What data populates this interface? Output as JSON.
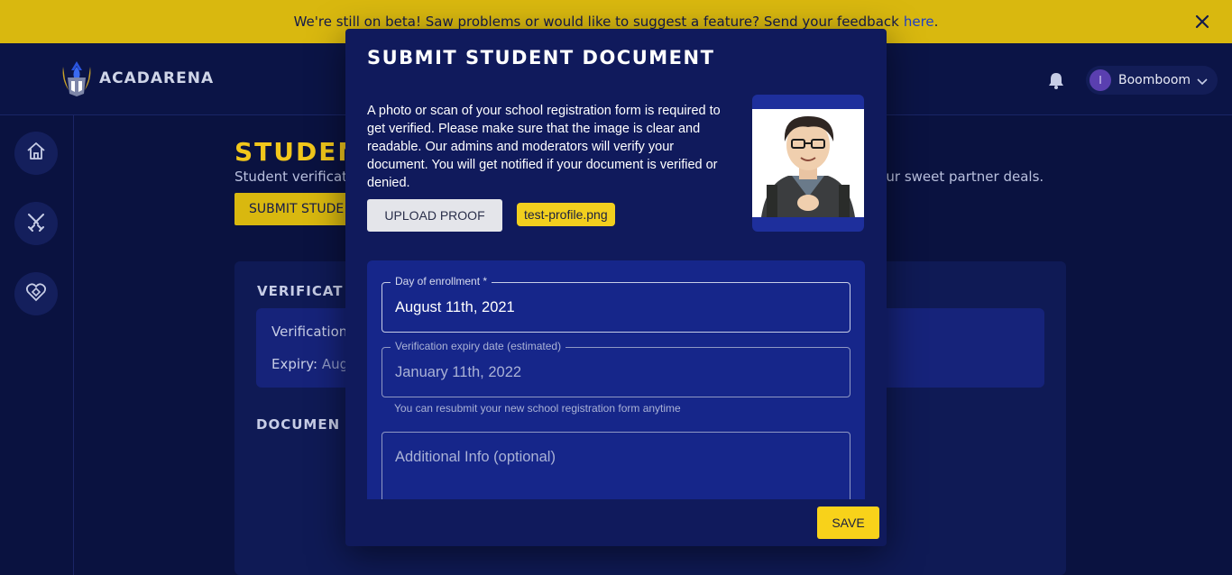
{
  "banner": {
    "message": "We're still on beta! Saw problems or would like to suggest a feature? Send your feedback",
    "link_text": "here",
    "period": ".",
    "close_icon": "close-icon"
  },
  "nav": {
    "brand_name": "ACADARENA",
    "bell_icon": "bell-icon",
    "user": {
      "initial": "I",
      "name": "Boomboom"
    }
  },
  "sidebar": {
    "items": [
      {
        "name": "home",
        "icon": "home-icon"
      },
      {
        "name": "battles",
        "icon": "swords-icon"
      },
      {
        "name": "partners",
        "icon": "handshake-heart-icon"
      }
    ]
  },
  "page": {
    "title": "STUDEN",
    "description": "Student verificatio",
    "description_right": "e of our sweet partner deals.",
    "submit_label": "SUBMIT STUDE",
    "verification_title": "VERIFICAT",
    "verification_label": "Verification:",
    "expiry_label": "Expiry:",
    "expiry_value": "Augu",
    "documents_title": "DOCUMEN"
  },
  "modal": {
    "title": "SUBMIT STUDENT DOCUMENT",
    "description": "A photo or scan of your school registration form is required to get verified. Please make sure that the image is clear and readable. Our admins and moderators will verify your document. You will get notified if your document is verified or denied.",
    "upload_label": "UPLOAD PROOF",
    "file_name": "test-profile.png",
    "fields": {
      "enrollment_label": "Day of enrollment *",
      "enrollment_value": "August 11th, 2021",
      "expiry_label": "Verification expiry date (estimated)",
      "expiry_value": "January 11th, 2022",
      "helper_text": "You can resubmit your new school registration form anytime",
      "additional_placeholder": "Additional Info (optional)"
    },
    "save_label": "SAVE"
  }
}
